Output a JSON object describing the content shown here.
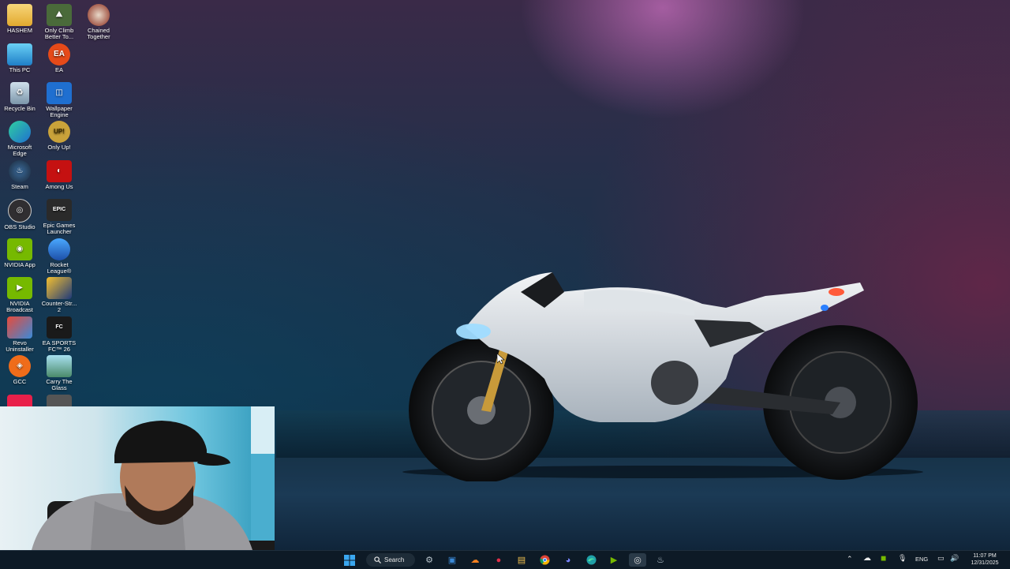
{
  "desktop": {
    "icons": [
      {
        "label": "HASHEM",
        "icon": "folder-icon",
        "color": "#f2c14e"
      },
      {
        "label": "Only Climb Better To...",
        "icon": "game-icon",
        "color": "#4a6a3a"
      },
      {
        "label": "Chained Together",
        "icon": "game-icon",
        "color": "#8a2a1a"
      },
      {
        "label": "This PC",
        "icon": "monitor-icon",
        "color": "#3aa7e0"
      },
      {
        "label": "EA",
        "icon": "ea-icon",
        "color": "#e64a19"
      },
      {
        "label": "Recycle Bin",
        "icon": "recycle-bin-icon",
        "color": "#9fb6c8"
      },
      {
        "label": "Wallpaper Engine",
        "icon": "wallpaper-engine-icon",
        "color": "#1f6fd0"
      },
      {
        "label": "Microsoft Edge",
        "icon": "edge-icon",
        "color": "#1fa0a8"
      },
      {
        "label": "Only Up!",
        "icon": "game-icon",
        "color": "#c9a23a"
      },
      {
        "label": "Steam",
        "icon": "steam-icon",
        "color": "#1b2838"
      },
      {
        "label": "Among Us",
        "icon": "among-us-icon",
        "color": "#c51111"
      },
      {
        "label": "OBS Studio",
        "icon": "obs-icon",
        "color": "#302e31"
      },
      {
        "label": "Epic Games Launcher",
        "icon": "epic-icon",
        "color": "#2a2a2a"
      },
      {
        "label": "NVIDIA App",
        "icon": "nvidia-icon",
        "color": "#76b900"
      },
      {
        "label": "Rocket League®",
        "icon": "rocket-league-icon",
        "color": "#1d6fd8"
      },
      {
        "label": "NVIDIA Broadcast",
        "icon": "nvidia-icon",
        "color": "#76b900"
      },
      {
        "label": "Counter-Str... 2",
        "icon": "cs2-icon",
        "color": "#e8a020"
      },
      {
        "label": "Revo Uninstaller",
        "icon": "revo-icon",
        "color": "#d84a3a"
      },
      {
        "label": "EA SPORTS FC™ 26",
        "icon": "fc-icon",
        "color": "#1a1a1a"
      },
      {
        "label": "GCC",
        "icon": "gcc-icon",
        "color": "#ef6c1a"
      },
      {
        "label": "Carry The Glass",
        "icon": "game-icon",
        "color": "#7ab8c8"
      }
    ]
  },
  "taskbar": {
    "search_label": "Search",
    "apps": [
      {
        "name": "settings-icon",
        "glyph": "⚙",
        "color": "#b8c4cc"
      },
      {
        "name": "screen-capture-icon",
        "glyph": "▭",
        "color": "#3a8ad8"
      },
      {
        "name": "cloudflare-icon",
        "glyph": "☁",
        "color": "#f38020"
      },
      {
        "name": "app-red-icon",
        "glyph": "●",
        "color": "#e0304a"
      },
      {
        "name": "file-explorer-icon",
        "glyph": "▤",
        "color": "#f2c14e"
      },
      {
        "name": "chrome-icon",
        "glyph": "◉",
        "color": "#4caf50"
      },
      {
        "name": "discord-icon",
        "glyph": "◕",
        "color": "#5865f2"
      },
      {
        "name": "edge-icon",
        "glyph": "◔",
        "color": "#1fa0a8"
      },
      {
        "name": "nvidia-broadcast-icon",
        "glyph": "▶",
        "color": "#76b900"
      },
      {
        "name": "obs-icon",
        "glyph": "◎",
        "color": "#c8c8c8"
      },
      {
        "name": "steam-icon",
        "glyph": "♨",
        "color": "#c8d6e0"
      }
    ],
    "tray": {
      "language": "ENG",
      "time": "11:07 PM",
      "date": "12/31/2025"
    }
  },
  "colors": {
    "taskbar_bg": "#0d1a26",
    "accent": "#3a8ad8"
  }
}
